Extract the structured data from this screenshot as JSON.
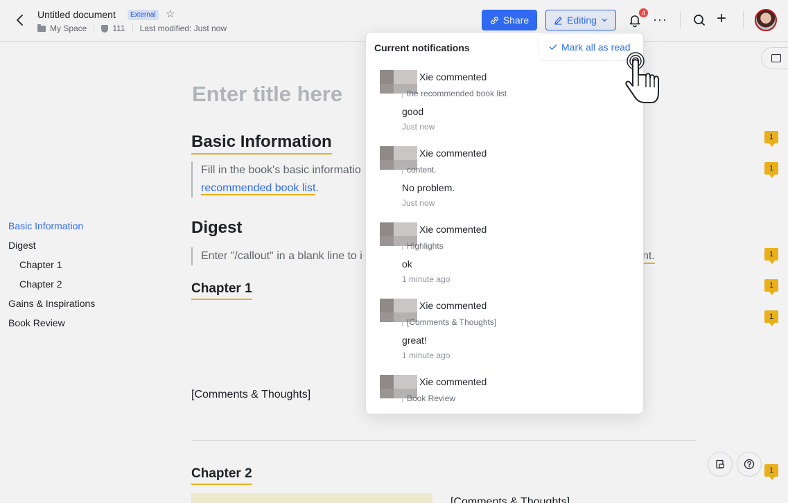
{
  "header": {
    "back_icon": "chevron-left-icon",
    "doc_title": "Untitled document",
    "badge": "External",
    "location": "My Space",
    "verified_count": "111",
    "last_modified": "Last modified: Just now",
    "share_label": "Share",
    "editing_label": "Editing",
    "notification_count": "4",
    "accent_color": "#3370ff"
  },
  "outline": {
    "items": [
      {
        "label": "Basic Information"
      },
      {
        "label": "Digest"
      },
      {
        "label": "Chapter 1"
      },
      {
        "label": "Chapter 2"
      },
      {
        "label": "Gains & Inspirations"
      },
      {
        "label": "Book Review"
      }
    ]
  },
  "doc": {
    "title_placeholder": "Enter title here",
    "h_basic": "Basic Information",
    "basic_quote_1": "Fill in the book's basic informatio",
    "basic_quote_link": "recommended book list",
    "basic_quote_end": ".",
    "h_digest": "Digest",
    "digest_quote": "Enter \"/callout\" in a blank line to i",
    "digest_quote_tail": "nt.",
    "h_ch1": "Chapter 1",
    "comments_thoughts": "[Comments & Thoughts]",
    "h_ch2": "Chapter 2",
    "comments_thoughts_2": "[Comments & Thoughts]",
    "comment_flag": "1"
  },
  "notifications": {
    "title": "Current notifications",
    "mark_all_label": "Mark all as read",
    "items": [
      {
        "who": "Xie commented",
        "ref": "the recommended book list",
        "msg": "good",
        "time": "Just now"
      },
      {
        "who": "Xie commented",
        "ref": "content.",
        "msg": "No problem.",
        "time": "Just now"
      },
      {
        "who": "Xie commented",
        "ref": "Highlights",
        "msg": "ok",
        "time": "1 minute ago"
      },
      {
        "who": "Xie commented",
        "ref": "[Comments & Thoughts]",
        "msg": "great!",
        "time": "1 minute ago"
      },
      {
        "who": "Xie commented",
        "ref": "Book Review",
        "msg": "",
        "time": ""
      }
    ]
  }
}
